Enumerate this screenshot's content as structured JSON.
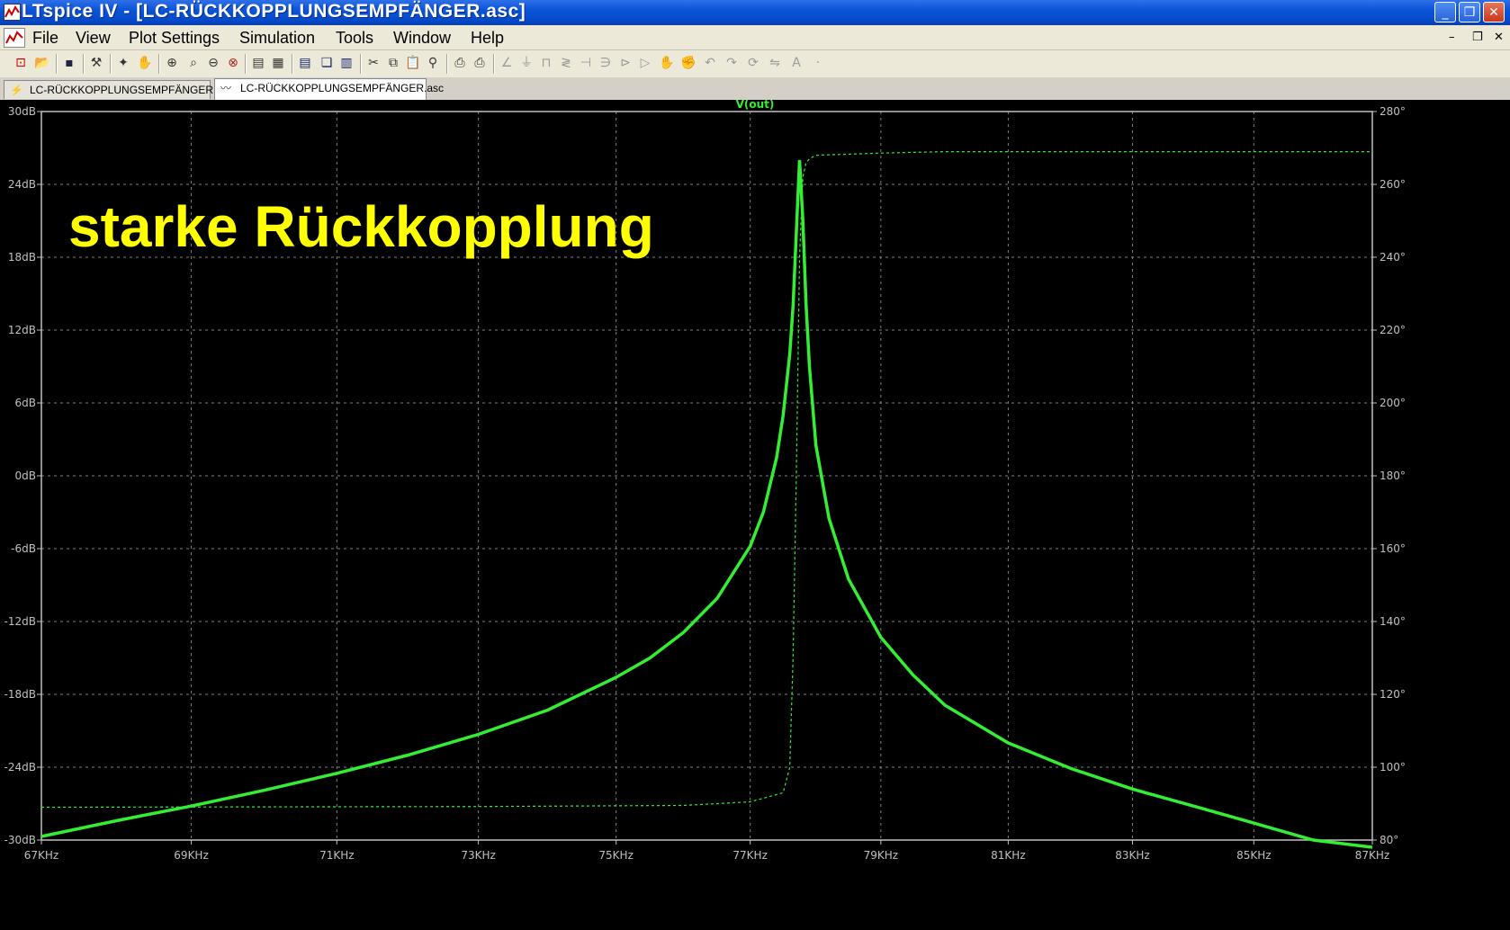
{
  "window": {
    "title": "LTspice IV - [LC-RÜCKKOPPLUNGSEMPFÄNGER.asc]",
    "minimize_glyph": "_",
    "restore_glyph": "❐",
    "close_glyph": "✕"
  },
  "menu": {
    "items": [
      "File",
      "View",
      "Plot Settings",
      "Simulation",
      "Tools",
      "Window",
      "Help"
    ],
    "mdi_minimize": "–",
    "mdi_restore": "❐",
    "mdi_close": "✕"
  },
  "toolbar": {
    "icons": [
      "new-schematic-icon",
      "open-icon",
      "save-icon",
      "control-panel-icon",
      "run-icon",
      "pan-icon",
      "zoom-in-icon",
      "zoom-box-icon",
      "zoom-out-icon",
      "zoom-fit-icon",
      "autorange-icon",
      "mark-icon",
      "tile-horizontal-icon",
      "cascade-icon",
      "tile-vertical-icon",
      "cut-icon",
      "copy-icon",
      "paste-icon",
      "find-icon",
      "print-preview-icon",
      "print-icon",
      "wire-icon",
      "ground-icon",
      "label-icon",
      "resistor-icon",
      "capacitor-icon",
      "inductor-icon",
      "diode-icon",
      "component-icon",
      "move-icon",
      "drag-icon",
      "undo-icon",
      "redo-icon",
      "rotate-icon",
      "mirror-icon",
      "text-icon",
      "spice-directive-icon"
    ]
  },
  "tabs": [
    {
      "label": "LC-RÜCKKOPPLUNGSEMPFÄNGER.asc",
      "icon": "schematic-icon",
      "active": false
    },
    {
      "label": "LC-RÜCKKOPPLUNGSEMPFÄNGER.asc",
      "icon": "waveform-icon",
      "active": true
    }
  ],
  "plot": {
    "trace_label": "V(out)",
    "overlay_text": "starke Rückkopplung",
    "colors": {
      "trace": "#33ee33",
      "axis": "#c0c0c0",
      "grid": "#808080",
      "background": "#000000",
      "overlay": "#ffff00"
    }
  },
  "chart_data": {
    "type": "line",
    "title": "V(out)",
    "x_scale": "log",
    "xlim": [
      67000,
      87000
    ],
    "x_ticks": [
      {
        "value": 67000,
        "label": "67KHz"
      },
      {
        "value": 69000,
        "label": "69KHz"
      },
      {
        "value": 71000,
        "label": "71KHz"
      },
      {
        "value": 73000,
        "label": "73KHz"
      },
      {
        "value": 75000,
        "label": "75KHz"
      },
      {
        "value": 77000,
        "label": "77KHz"
      },
      {
        "value": 79000,
        "label": "79KHz"
      },
      {
        "value": 81000,
        "label": "81KHz"
      },
      {
        "value": 83000,
        "label": "83KHz"
      },
      {
        "value": 85000,
        "label": "85KHz"
      },
      {
        "value": 87000,
        "label": "87KHz"
      }
    ],
    "y_left": {
      "unit": "dB",
      "lim": [
        -30,
        30
      ],
      "ticks": [
        "30dB",
        "24dB",
        "18dB",
        "12dB",
        "6dB",
        "0dB",
        "-6dB",
        "-12dB",
        "-18dB",
        "-24dB",
        "-30dB"
      ]
    },
    "y_right": {
      "unit": "°",
      "lim": [
        80,
        280
      ],
      "ticks": [
        "280°",
        "260°",
        "240°",
        "220°",
        "200°",
        "180°",
        "160°",
        "140°",
        "120°",
        "100°",
        "80°"
      ]
    },
    "grid": true,
    "series": [
      {
        "name": "V(out) magnitude",
        "axis": "left",
        "style": "solid",
        "x": [
          67000,
          68000,
          69000,
          70000,
          71000,
          72000,
          73000,
          74000,
          75000,
          75500,
          76000,
          76500,
          77000,
          77200,
          77400,
          77500,
          77600,
          77650,
          77700,
          77750,
          77800,
          77850,
          77900,
          78000,
          78200,
          78500,
          79000,
          79500,
          80000,
          81000,
          82000,
          83000,
          84000,
          85000,
          86000,
          87000
        ],
        "y": [
          -29.7,
          -28.4,
          -27.2,
          -25.9,
          -24.5,
          -23.0,
          -21.3,
          -19.3,
          -16.6,
          -15.0,
          -12.9,
          -10.1,
          -5.8,
          -3.0,
          1.5,
          5.0,
          10.0,
          14.0,
          20.0,
          26.0,
          21.0,
          14.0,
          9.0,
          2.5,
          -3.5,
          -8.5,
          -13.3,
          -16.4,
          -18.9,
          -22.0,
          -24.1,
          -25.8,
          -27.2,
          -28.6,
          -30.0,
          -31.2
        ]
      },
      {
        "name": "V(out) phase",
        "axis": "right",
        "style": "dashed",
        "x": [
          67000,
          70000,
          73000,
          76000,
          77000,
          77500,
          77600,
          77650,
          77700,
          77750,
          77800,
          77850,
          77900,
          78000,
          79000,
          80000,
          87000
        ],
        "y": [
          89.0,
          89.1,
          89.2,
          89.5,
          90.5,
          93.0,
          100.0,
          130.0,
          180.0,
          240.0,
          262.0,
          266.0,
          267.0,
          268.0,
          268.6,
          269.0,
          269.0
        ]
      }
    ]
  }
}
